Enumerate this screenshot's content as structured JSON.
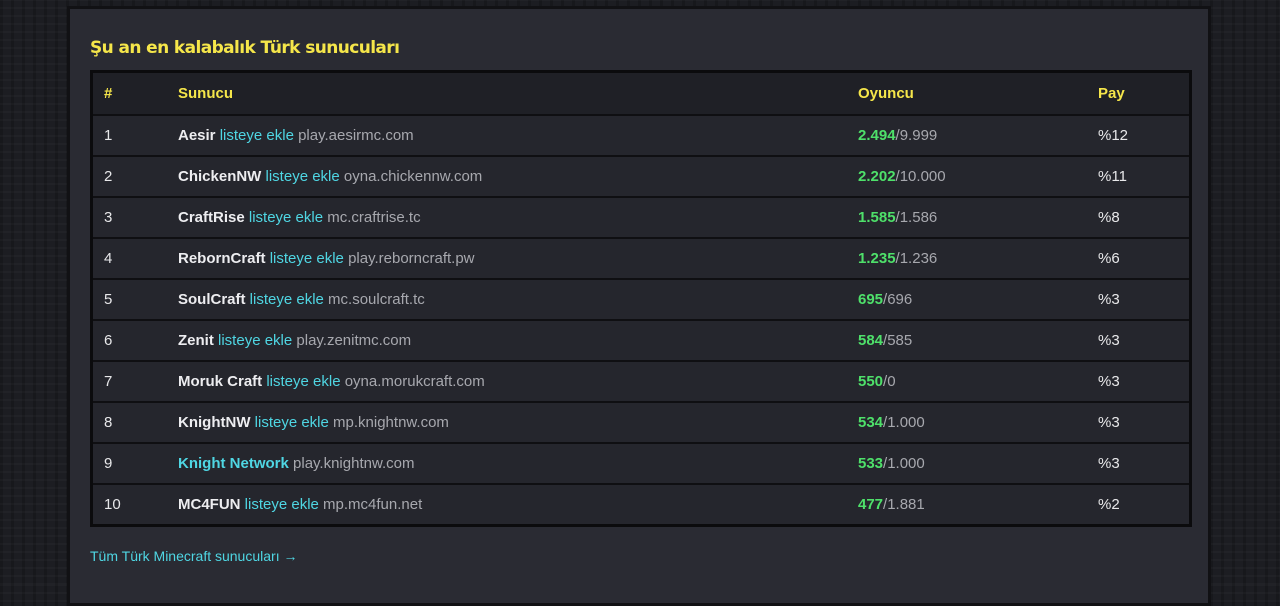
{
  "section": {
    "title": "Şu an en kalabalık Türk sunucuları",
    "footer_link": "Tüm Türk Minecraft sunucuları →"
  },
  "table": {
    "headers": {
      "rank": "#",
      "server": "Sunucu",
      "players": "Oyuncu",
      "share": "Pay"
    },
    "rows": [
      {
        "rank": "1",
        "name": "Aesir",
        "add": "listeye ekle",
        "address": "play.aesirmc.com",
        "online": "2.494",
        "capacity": "/9.999",
        "share": "%12"
      },
      {
        "rank": "2",
        "name": "ChickenNW",
        "add": "listeye ekle",
        "address": "oyna.chickennw.com",
        "online": "2.202",
        "capacity": "/10.000",
        "share": "%11"
      },
      {
        "rank": "3",
        "name": "CraftRise",
        "add": "listeye ekle",
        "address": "mc.craftrise.tc",
        "online": "1.585",
        "capacity": "/1.586",
        "share": "%8"
      },
      {
        "rank": "4",
        "name": "RebornCraft",
        "add": "listeye ekle",
        "address": "play.reborncraft.pw",
        "online": "1.235",
        "capacity": "/1.236",
        "share": "%6"
      },
      {
        "rank": "5",
        "name": "SoulCraft",
        "add": "listeye ekle",
        "address": "mc.soulcraft.tc",
        "online": "695",
        "capacity": "/696",
        "share": "%3"
      },
      {
        "rank": "6",
        "name": "Zenit",
        "add": "listeye ekle",
        "address": "play.zenitmc.com",
        "online": "584",
        "capacity": "/585",
        "share": "%3"
      },
      {
        "rank": "7",
        "name": "Moruk Craft",
        "add": "listeye ekle",
        "address": "oyna.morukcraft.com",
        "online": "550",
        "capacity": "/0",
        "share": "%3"
      },
      {
        "rank": "8",
        "name": "KnightNW",
        "add": "listeye ekle",
        "address": "mp.knightnw.com",
        "online": "534",
        "capacity": "/1.000",
        "share": "%3"
      },
      {
        "rank": "9",
        "name": "Knight Network",
        "add": "",
        "address": "play.knightnw.com",
        "online": "533",
        "capacity": "/1.000",
        "share": "%3",
        "name_is_link": true
      },
      {
        "rank": "10",
        "name": "MC4FUN",
        "add": "listeye ekle",
        "address": "mp.mc4fun.net",
        "online": "477",
        "capacity": "/1.881",
        "share": "%2"
      }
    ]
  }
}
